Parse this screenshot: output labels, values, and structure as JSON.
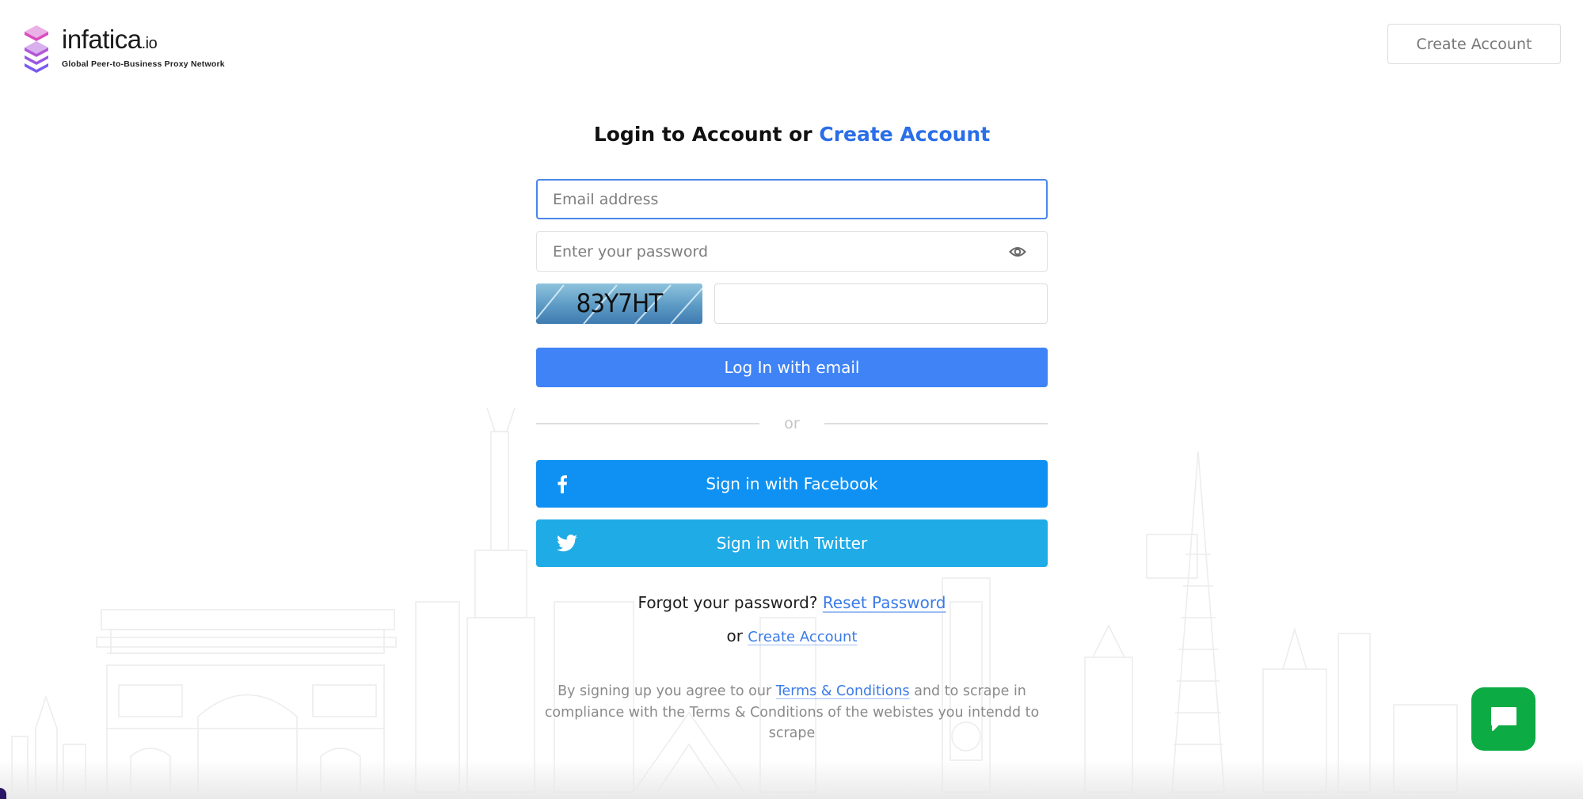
{
  "header": {
    "logo": {
      "name": "infatica",
      "tld": ".io",
      "tagline": "Global Peer-to-Business Proxy Network",
      "icon": "layered-stack-icon"
    },
    "create_account_button": "Create Account"
  },
  "form": {
    "title_prefix": "Login to Account or ",
    "title_link": "Create Account",
    "email": {
      "placeholder": "Email address",
      "value": ""
    },
    "password": {
      "placeholder": "Enter your password",
      "value": "",
      "toggle_icon": "eye-icon"
    },
    "captcha": {
      "code": "83Y7HT",
      "value": ""
    },
    "login_button": "Log In with email",
    "divider_text": "or",
    "facebook_button": {
      "label": "Sign in with Facebook",
      "icon": "facebook-icon"
    },
    "twitter_button": {
      "label": "Sign in with Twitter",
      "icon": "twitter-icon"
    },
    "forgot_text": "Forgot your password? ",
    "reset_link": "Reset Password",
    "or_text": "or ",
    "create_account_link": "Create Account",
    "terms": {
      "prefix": "By signing up you agree to our ",
      "link": "Terms & Conditions",
      "suffix": " and to scrape in compliance with the Terms & Conditions of the webistes you intendd to scrape"
    }
  },
  "chat_widget": {
    "icon": "chat-bubble-icon"
  },
  "colors": {
    "brand_link": "#2a6ee8",
    "login_button": "#3f83f6",
    "facebook": "#0e91f2",
    "twitter": "#1fabe6",
    "chat": "#0dab43",
    "logo_gradient": [
      "#e24fc6",
      "#b05ae6",
      "#7a5af2"
    ]
  }
}
